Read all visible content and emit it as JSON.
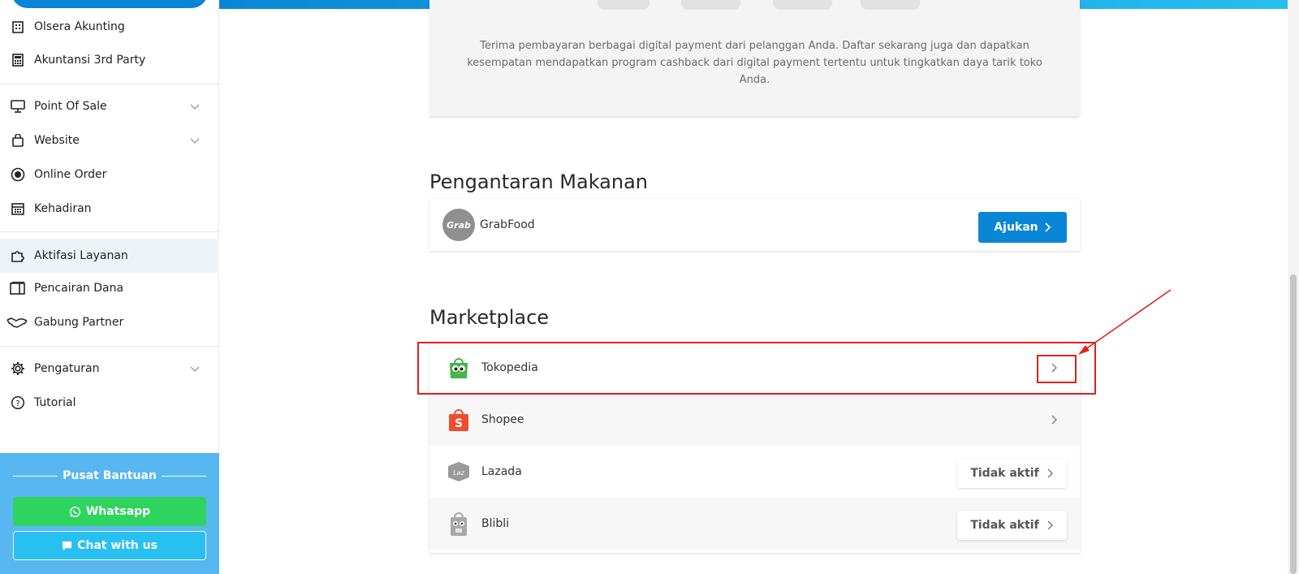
{
  "sidebar": {
    "items": [
      {
        "label": "Olsera Akunting",
        "icon": "building-icon"
      },
      {
        "label": "Akuntansi 3rd Party",
        "icon": "calculator-icon"
      },
      {
        "label": "Point Of Sale",
        "icon": "monitor-icon"
      },
      {
        "label": "Website",
        "icon": "shopping-bag-icon"
      },
      {
        "label": "Online Order",
        "icon": "radio-dot-icon"
      },
      {
        "label": "Kehadiran",
        "icon": "calendar-icon"
      },
      {
        "label": "Aktifasi Layanan",
        "icon": "puzzle-icon"
      },
      {
        "label": "Pencairan Dana",
        "icon": "wallet-icon"
      },
      {
        "label": "Gabung Partner",
        "icon": "handshake-icon"
      },
      {
        "label": "Pengaturan",
        "icon": "gear-icon"
      },
      {
        "label": "Tutorial",
        "icon": "help-circle-icon"
      }
    ],
    "help": {
      "title": "Pusat Bantuan",
      "whatsapp": "Whatsapp",
      "chat": "Chat with us"
    }
  },
  "payment": {
    "description": "Terima pembayaran berbagai digital payment dari pelanggan Anda. Daftar sekarang juga dan dapatkan kesempatan mendapatkan program cashback dari digital payment tertentu untuk tingkatkan daya tarik toko Anda."
  },
  "food": {
    "title": "Pengantaran Makanan",
    "grabfood": {
      "label": "GrabFood",
      "logo_text": "Grab",
      "button": "Ajukan"
    }
  },
  "marketplace": {
    "title": "Marketplace",
    "items": [
      {
        "label": "Tokopedia"
      },
      {
        "label": "Shopee"
      },
      {
        "label": "Lazada",
        "logo_text": "Laz",
        "status": "Tidak aktif"
      },
      {
        "label": "Blibli",
        "status": "Tidak aktif"
      }
    ]
  },
  "colors": {
    "primary": "#0a86d6",
    "whatsapp": "#2fd45f",
    "chat": "#27c0f0",
    "annotation": "#e01f1f"
  }
}
